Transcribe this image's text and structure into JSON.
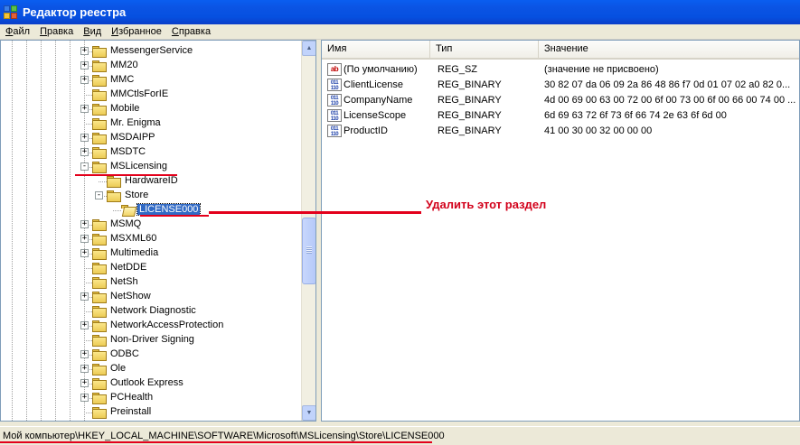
{
  "window": {
    "title": "Редактор реестра"
  },
  "menu": [
    {
      "label": "Файл",
      "accel": "Ф",
      "rest": "айл"
    },
    {
      "label": "Правка",
      "accel": "П",
      "rest": "равка"
    },
    {
      "label": "Вид",
      "accel": "В",
      "rest": "ид"
    },
    {
      "label": "Избранное",
      "accel": "И",
      "rest": "збранное"
    },
    {
      "label": "Справка",
      "accel": "С",
      "rest": "правка"
    }
  ],
  "tree": {
    "items": [
      {
        "label": "MessengerService",
        "level": 0,
        "expander": "+"
      },
      {
        "label": "MM20",
        "level": 0,
        "expander": "+"
      },
      {
        "label": "MMC",
        "level": 0,
        "expander": "+"
      },
      {
        "label": "MMCtlsForIE",
        "level": 0,
        "expander": ""
      },
      {
        "label": "Mobile",
        "level": 0,
        "expander": "+"
      },
      {
        "label": "Mr. Enigma",
        "level": 0,
        "expander": ""
      },
      {
        "label": "MSDAIPP",
        "level": 0,
        "expander": "+"
      },
      {
        "label": "MSDTC",
        "level": 0,
        "expander": "+"
      },
      {
        "label": "MSLicensing",
        "level": 0,
        "expander": "-"
      },
      {
        "label": "HardwareID",
        "level": 1,
        "expander": ""
      },
      {
        "label": "Store",
        "level": 1,
        "expander": "-"
      },
      {
        "label": "LICENSE000",
        "level": 2,
        "expander": "",
        "selected": true,
        "open": true
      },
      {
        "label": "MSMQ",
        "level": 0,
        "expander": "+"
      },
      {
        "label": "MSXML60",
        "level": 0,
        "expander": "+"
      },
      {
        "label": "Multimedia",
        "level": 0,
        "expander": "+"
      },
      {
        "label": "NetDDE",
        "level": 0,
        "expander": ""
      },
      {
        "label": "NetSh",
        "level": 0,
        "expander": ""
      },
      {
        "label": "NetShow",
        "level": 0,
        "expander": "+"
      },
      {
        "label": "Network Diagnostic",
        "level": 0,
        "expander": ""
      },
      {
        "label": "NetworkAccessProtection",
        "level": 0,
        "expander": "+"
      },
      {
        "label": "Non-Driver Signing",
        "level": 0,
        "expander": ""
      },
      {
        "label": "ODBC",
        "level": 0,
        "expander": "+"
      },
      {
        "label": "Ole",
        "level": 0,
        "expander": "+"
      },
      {
        "label": "Outlook Express",
        "level": 0,
        "expander": "+"
      },
      {
        "label": "PCHealth",
        "level": 0,
        "expander": "+"
      },
      {
        "label": "Preinstall",
        "level": 0,
        "expander": ""
      }
    ]
  },
  "list": {
    "columns": [
      "Имя",
      "Тип",
      "Значение"
    ],
    "rows": [
      {
        "icon": "ab",
        "name": "(По умолчанию)",
        "type": "REG_SZ",
        "value": "(значение не присвоено)"
      },
      {
        "icon": "bin",
        "name": "ClientLicense",
        "type": "REG_BINARY",
        "value": "30 82 07 da 06 09 2a 86 48 86 f7 0d 01 07 02 a0 82 0..."
      },
      {
        "icon": "bin",
        "name": "CompanyName",
        "type": "REG_BINARY",
        "value": "4d 00 69 00 63 00 72 00 6f 00 73 00 6f 00 66 00 74 00 ..."
      },
      {
        "icon": "bin",
        "name": "LicenseScope",
        "type": "REG_BINARY",
        "value": "6d 69 63 72 6f 73 6f 66 74 2e 63 6f 6d 00"
      },
      {
        "icon": "bin",
        "name": "ProductID",
        "type": "REG_BINARY",
        "value": "41 00 30 00 32 00 00 00"
      }
    ]
  },
  "status": {
    "path": "Мой компьютер\\HKEY_LOCAL_MACHINE\\SOFTWARE\\Microsoft\\MSLicensing\\Store\\LICENSE000"
  },
  "annotation": {
    "text": "Удалить этот раздел",
    "color": "#e3001b"
  },
  "colors": {
    "titlebar": "#0a5ef0",
    "selection": "#316ac5",
    "accent": "#e3001b"
  },
  "icons": {
    "app": "registry-editor-icon",
    "folder": "folder-icon",
    "string_value": "string-value-icon",
    "binary_value": "binary-value-icon"
  }
}
